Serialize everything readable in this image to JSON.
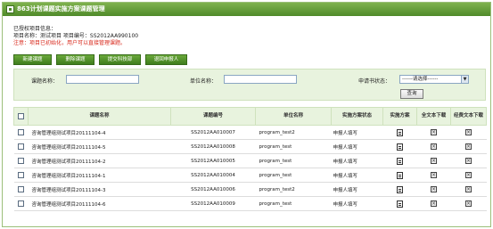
{
  "window": {
    "title": "863计划课题实施方案课题管理"
  },
  "info": {
    "line1": "已授权项目信息：",
    "line2": "项目名称：测试项目  项目编号：SS2012AA990100",
    "line3": "注意：项目已初始化，用户可以直接管理课题。"
  },
  "toolbar": {
    "new_label": "新建课题",
    "delete_label": "删除课题",
    "submit_label": "提交科技部",
    "return_label": "退回申报人"
  },
  "search": {
    "topic_label": "课题名称：",
    "unit_label": "单位名称：",
    "status_label": "申请书状态：",
    "status_selected": "------请选择------",
    "query_label": "查询"
  },
  "table": {
    "headers": {
      "name": "课题名称",
      "code": "课题编号",
      "unit": "单位名称",
      "status": "实施方案状态",
      "plan": "实施方案",
      "fulltext": "全文本下载",
      "budget": "经费文本下载"
    },
    "rows": [
      {
        "name": "咨询管理组测试项目20111104-4",
        "code": "SS2012AA010007",
        "unit": "program_test2",
        "status": "申报人填写"
      },
      {
        "name": "咨询管理组测试项目20111104-5",
        "code": "SS2012AA010008",
        "unit": "program_test",
        "status": "申报人填写"
      },
      {
        "name": "咨询管理组测试项目20111104-2",
        "code": "SS2012AA010005",
        "unit": "program_test",
        "status": "申报人填写"
      },
      {
        "name": "咨询管理组测试项目20111104-1",
        "code": "SS2012AA010004",
        "unit": "program_test",
        "status": "申报人填写"
      },
      {
        "name": "咨询管理组测试项目20111104-3",
        "code": "SS2012AA010006",
        "unit": "program_test2",
        "status": "申报人填写"
      },
      {
        "name": "咨询管理组测试项目20111104-6",
        "code": "SS2012AA010009",
        "unit": "program_test",
        "status": "申报人填写"
      }
    ]
  }
}
